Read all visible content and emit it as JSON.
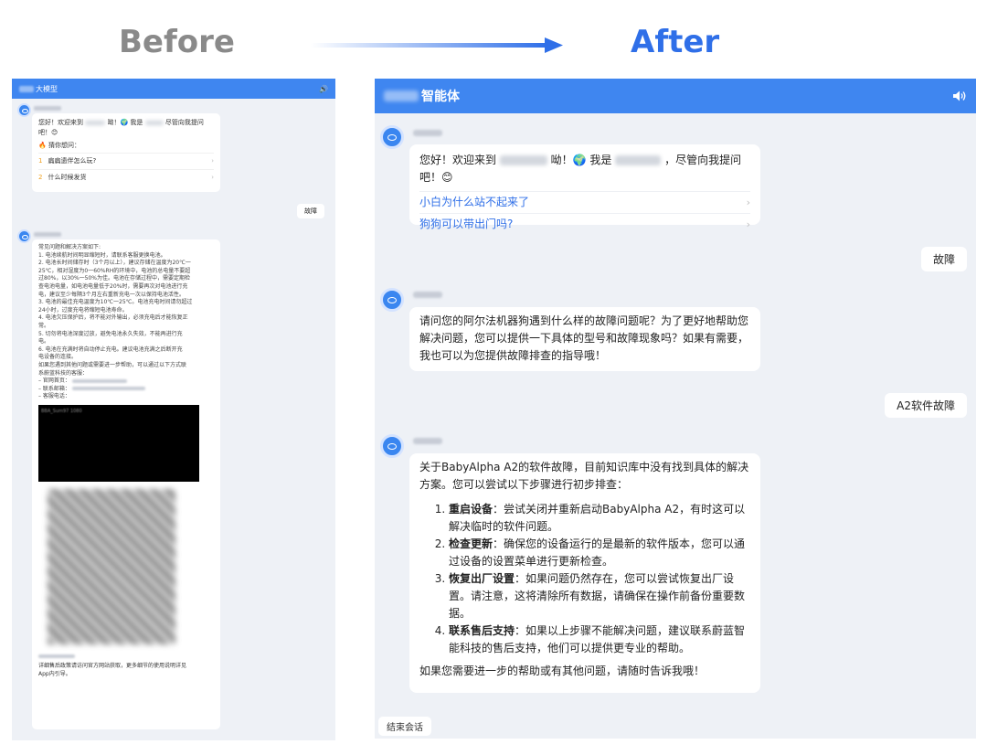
{
  "header": {
    "before_label": "Before",
    "after_label": "After"
  },
  "before": {
    "header_title": "大模型",
    "greeting": "您好！欢迎来到",
    "greeting_mid": "呦！🌍 我是",
    "greeting_end": "尽管向我提问吧！😊",
    "guess_label": "猜你想问：",
    "suggestions": [
      {
        "num": "1",
        "text": "扁扁遗伴怎么玩?"
      },
      {
        "num": "2",
        "text": "什么时候发货"
      }
    ],
    "user_message": "故障",
    "reply_lines": [
      "常见问题和解决方案如下:",
      "1. 电池续航时间明显缩短时，请联系客服更换电池。",
      "2. 电池长时间储存时（3个月以上），建议存储在温度为20℃一",
      "25℃，相对湿度为0一60%RH的环境中，电池的总电量不要超",
      "过80%，以30%一50%为佳。电池在存储过程中，需要定期检",
      "查电池电量，如电池电量低于20%时，需要再次对电池进行充",
      "电，建议至少每隔3个月左右重新充电一次以保持电池活性。",
      "3. 电池的最佳充电温度为10℃一25℃。电池充电时间请勿超过",
      "24小时，过度充电将缩短电池寿命。",
      "4. 电池欠压保护后，将不能对外输出，必须充电后才能恢复正",
      "常。",
      "5. 切勿将电池深度过放，避免电池永久失效，不能再进行充",
      "电。",
      "6. 电池在充满时将自动停止充电。建议电池充满之后断开充",
      "电设备的连接。",
      "如果您遇到其他问题或需要进一步帮助，可以通过以下方式联",
      "系蔚蓝科技的客服："
    ],
    "contact_items": [
      "– 官网首页：",
      "– 联系邮箱：",
      "– 客服电话："
    ],
    "video_caption": "BBA_Sum97 1080",
    "footer_lines": [
      "详细售后政策请访问官方网站获取，更多细节的使用说明详见",
      "App内引导。"
    ]
  },
  "after": {
    "header_title": "智能体",
    "greeting_start": "您好！欢迎来到",
    "greeting_mid": "呦！🌍 我是",
    "greeting_end": "，尽管向我提问吧！😊",
    "suggestions": [
      "小白为什么站不起来了",
      "狗狗可以带出门吗?"
    ],
    "user_message_1": "故障",
    "reply_1": "请问您的阿尔法机器狗遇到什么样的故障问题呢？为了更好地帮助您解决问题，您可以提供一下具体的型号和故障现象吗？如果有需要，我也可以为您提供故障排查的指导哦！",
    "user_message_2": "A2软件故障",
    "reply_2_intro": "关于BabyAlpha A2的软件故障，目前知识库中没有找到具体的解决方案。您可以尝试以下步骤进行初步排查：",
    "steps": [
      {
        "title": "重启设备",
        "text": "：尝试关闭并重新启动BabyAlpha A2，有时这可以解决临时的软件问题。"
      },
      {
        "title": "检查更新",
        "text": "：确保您的设备运行的是最新的软件版本，您可以通过设备的设置菜单进行更新检查。"
      },
      {
        "title": "恢复出厂设置",
        "text": "：如果问题仍然存在，您可以尝试恢复出厂设置。请注意，这将清除所有数据，请确保在操作前备份重要数据。"
      },
      {
        "title": "联系售后支持",
        "text": "：如果以上步骤不能解决问题，建议联系蔚蓝智能科技的售后支持，他们可以提供更专业的帮助。"
      }
    ],
    "reply_2_outro": "如果您需要进一步的帮助或有其他问题，请随时告诉我哦！",
    "end_button": "结束会话"
  },
  "colors": {
    "brand": "#3f86f0",
    "accent_text": "#2f6fe8",
    "panel_bg": "#eef1f6"
  }
}
